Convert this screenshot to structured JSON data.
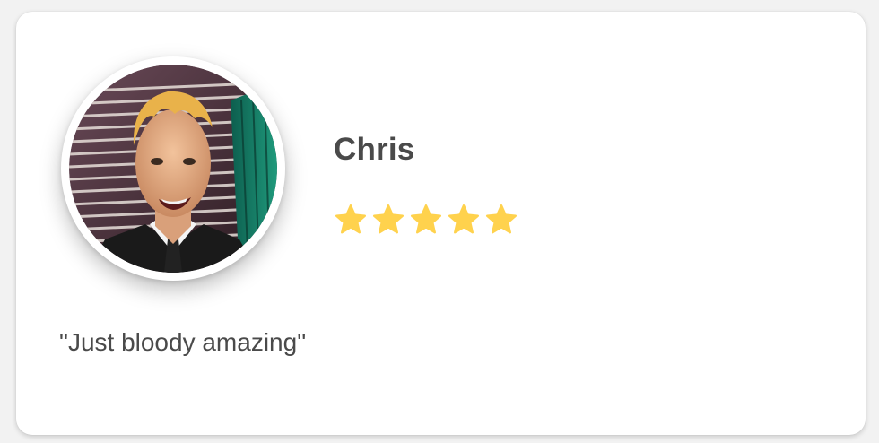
{
  "review": {
    "name": "Chris",
    "rating": 5,
    "rating_max": 5,
    "quote": "\"Just bloody amazing\""
  },
  "colors": {
    "star": "#ffd24d",
    "text": "#4a4a4a",
    "card": "#ffffff"
  },
  "icons": [
    "avatar-photo",
    "star-icon"
  ]
}
